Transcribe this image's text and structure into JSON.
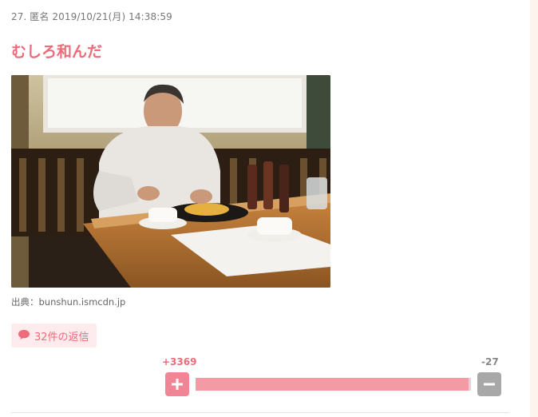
{
  "post": {
    "meta": "27. 匿名 2019/10/21(月) 14:38:59",
    "title": "むしろ和んだ",
    "image_alt": "photo",
    "source": "出典：bunshun.ismcdn.jp"
  },
  "replies": {
    "label": "32件の返信",
    "icon": "speech-bubble-icon"
  },
  "votes": {
    "plus": "+3369",
    "minus": "-27",
    "plus_fraction": 0.992,
    "plus_icon": "plus-icon",
    "minus_icon": "minus-icon"
  },
  "colors": {
    "accent": "#ee6b7a",
    "plus_button": "#f08596",
    "minus_button": "#a8a8a8",
    "bar_fill": "#f39aa5"
  }
}
